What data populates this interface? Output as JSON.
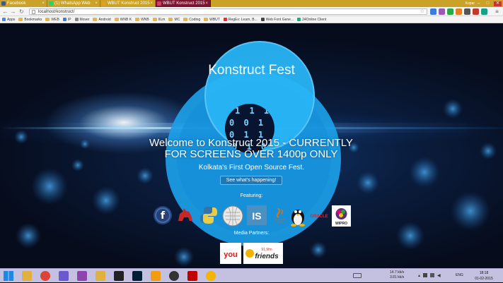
{
  "browser": {
    "tabs": [
      {
        "title": "Facebook",
        "color": "#3b5998"
      },
      {
        "title": "(1) WhatsApp Web",
        "color": "#25d366"
      },
      {
        "title": "WBUT Konstruct 2015",
        "color": "#e0a020"
      },
      {
        "title": "WBUT Konstruct 2015",
        "color": "#d04060",
        "active": true
      }
    ],
    "user": "Kopar",
    "url": "localhost/konstruct/",
    "bookmarks": [
      {
        "label": "Apps",
        "kind": "sq",
        "color": "#4285f4"
      },
      {
        "label": "Bookmarks",
        "kind": "folder"
      },
      {
        "label": "WEB",
        "kind": "folder"
      },
      {
        "label": "IP",
        "kind": "sq",
        "color": "#3a7bd5"
      },
      {
        "label": "Mover",
        "kind": "sq",
        "color": "#888888"
      },
      {
        "label": "Android",
        "kind": "folder"
      },
      {
        "label": "WNB K",
        "kind": "folder"
      },
      {
        "label": "WNB",
        "kind": "folder"
      },
      {
        "label": "IILm",
        "kind": "folder"
      },
      {
        "label": "MC",
        "kind": "folder"
      },
      {
        "label": "Coding",
        "kind": "folder"
      },
      {
        "label": "WBUT",
        "kind": "folder"
      },
      {
        "label": "RegEx: Learn, B...",
        "kind": "sq",
        "color": "#d33"
      },
      {
        "label": "Web Font Gene...",
        "kind": "sq",
        "color": "#444"
      },
      {
        "label": "24Online Client",
        "kind": "sq",
        "color": "#2a7"
      }
    ]
  },
  "hero": {
    "title": "Konstruct Fest",
    "binary": [
      "1 1 1",
      "0 0 1",
      "0 1 1",
      "0 1 0"
    ],
    "headline": "Welcome to Konstruct 2015 - CURRENTLY FOR SCREENS OVER 1400p ONLY",
    "subtitle": "Kolkata's First Open Source Fest.",
    "cta": "See what's happening!",
    "featuring_label": "Featuring:",
    "media_label": "Media Partners:"
  },
  "logos": [
    {
      "name": "fedora-logo",
      "icon": "fedora"
    },
    {
      "name": "perl-logo",
      "icon": "camel"
    },
    {
      "name": "python-logo",
      "icon": "python"
    },
    {
      "name": "wikipedia-logo",
      "icon": "wikipedia"
    },
    {
      "name": "is-logo",
      "icon": "is",
      "text": "IS"
    },
    {
      "name": "java-logo",
      "icon": "java"
    },
    {
      "name": "linux-logo",
      "icon": "tux"
    },
    {
      "name": "oracle-logo",
      "icon": "oracle",
      "text": "ORACLE"
    },
    {
      "name": "wipro-logo",
      "icon": "wipro",
      "text": "WIPRO"
    }
  ],
  "media_partners": [
    {
      "name": "you-logo",
      "text": "you"
    },
    {
      "name": "radio-friends-logo",
      "text": "friends",
      "freq": "91.9fm"
    }
  ],
  "taskbar": {
    "pinned": [
      "start-button",
      "file-explorer-icon",
      "chrome-icon",
      "calculator-icon",
      "media-icon",
      "folder-icon",
      "cmd-icon",
      "photoshop-icon",
      "photos-icon",
      "github-icon",
      "filezilla-icon",
      "chrome-canary-icon"
    ],
    "net_up": "14.7 kb/s",
    "net_down": "3.81 kb/s",
    "lang": "ENG",
    "time": "18:18",
    "date": "01-02-2015"
  },
  "colors": {
    "accent": "#1ca0e8",
    "taskbar": "#c4c0df",
    "tabstrip": "#c9a227"
  }
}
